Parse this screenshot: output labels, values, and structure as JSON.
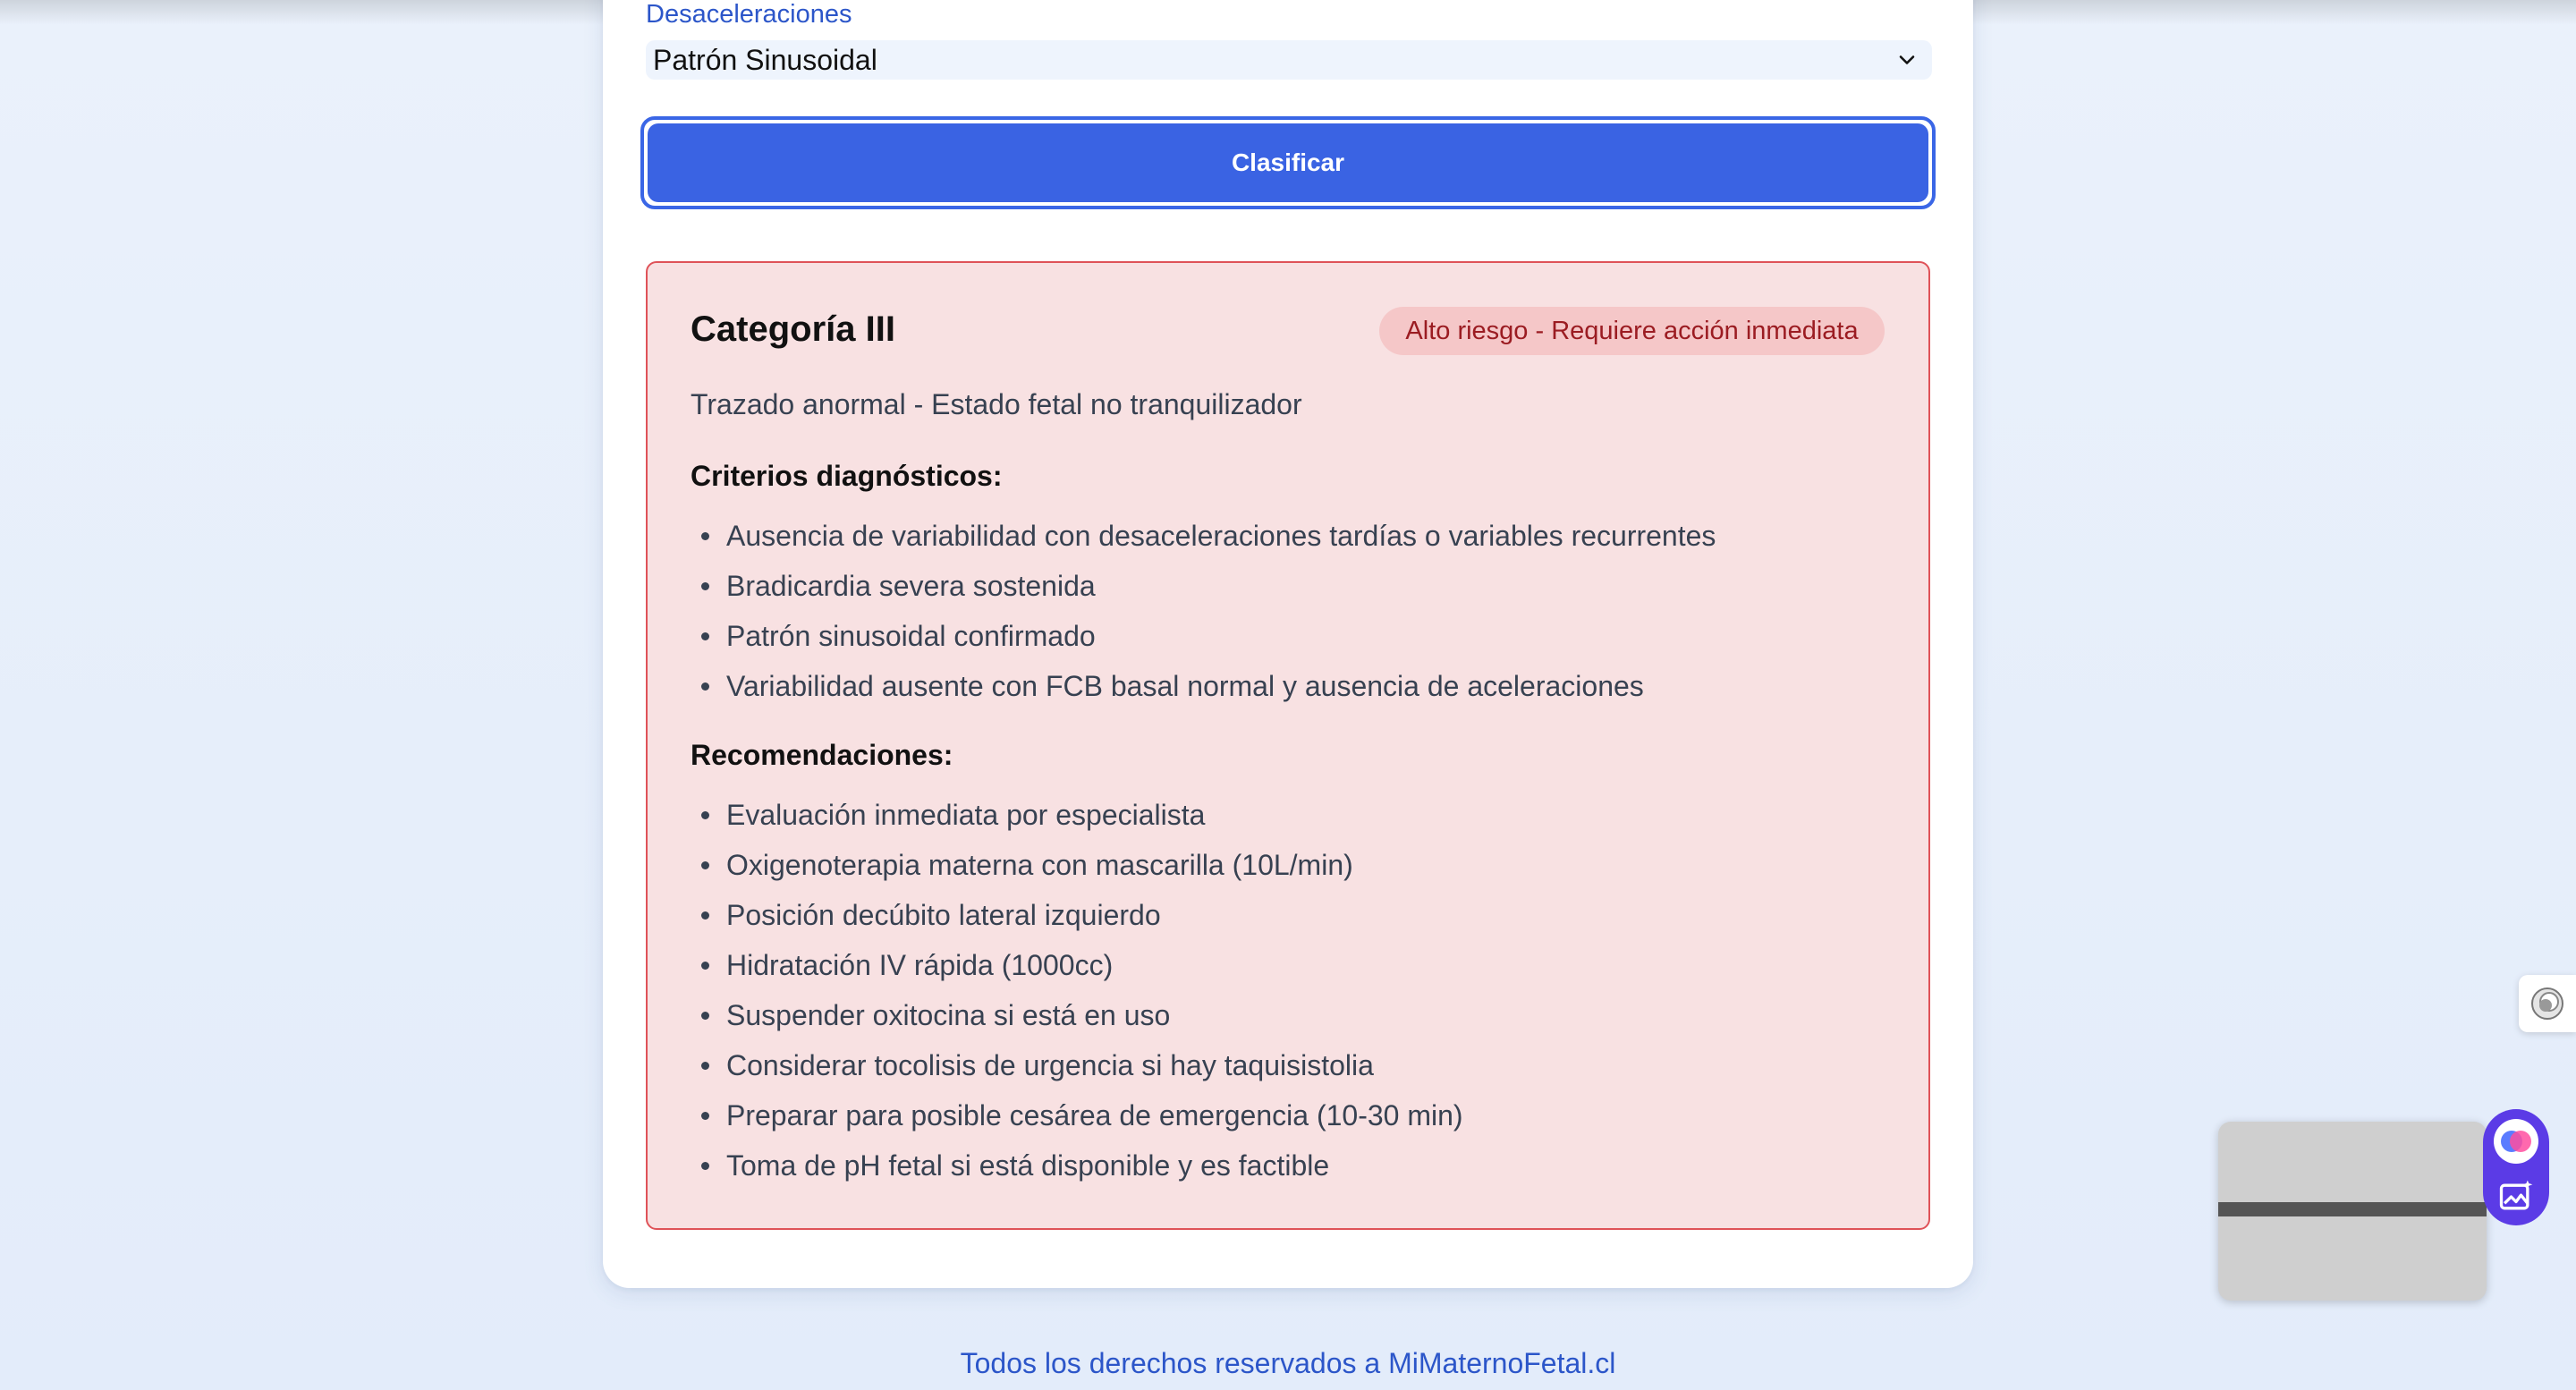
{
  "form": {
    "field_label": "Desaceleraciones",
    "select_value": "Patrón Sinusoidal",
    "submit_label": "Clasificar"
  },
  "result": {
    "category": "Categoría III",
    "badge": "Alto riesgo - Requiere acción inmediata",
    "description": "Trazado anormal - Estado fetal no tranquilizador",
    "criteria_title": "Criterios diagnósticos:",
    "criteria": [
      "Ausencia de variabilidad con desaceleraciones tardías o variables recurrentes",
      "Bradicardia severa sostenida",
      "Patrón sinusoidal confirmado",
      "Variabilidad ausente con FCB basal normal y ausencia de aceleraciones"
    ],
    "recommendations_title": "Recomendaciones:",
    "recommendations": [
      "Evaluación inmediata por especialista",
      "Oxigenoterapia materna con mascarilla (10L/min)",
      "Posición decúbito lateral izquierdo",
      "Hidratación IV rápida (1000cc)",
      "Suspender oxitocina si está en uso",
      "Considerar tocolisis de urgencia si hay taquisistolia",
      "Preparar para posible cesárea de emergencia (10-30 min)",
      "Toma de pH fetal si está disponible y es factible"
    ]
  },
  "footer": {
    "text": "Todos los derechos reservados a MiMaternoFetal.cl"
  },
  "colors": {
    "accent": "#3a63e3",
    "danger_bg": "#f8e1e2",
    "danger_border": "#df5258",
    "badge_text": "#9b1c22"
  },
  "icons": {
    "select": "chevron-down-icon",
    "extension": "extension-icon",
    "assistant": "assistant-icon",
    "image": "image-sparkle-icon"
  }
}
